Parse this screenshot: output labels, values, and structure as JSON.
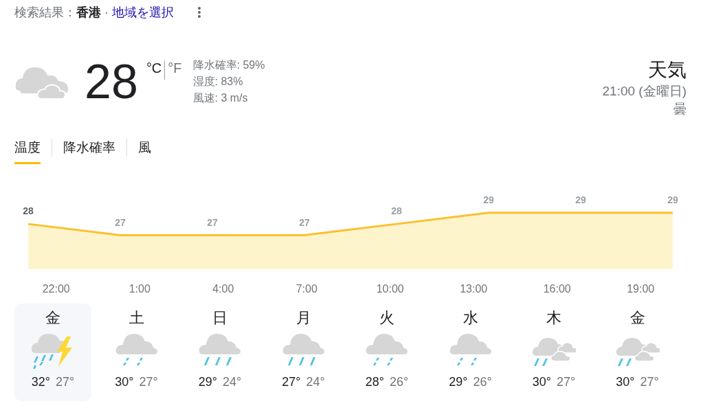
{
  "search_header": {
    "prefix": "検索結果：",
    "place": "香港",
    "separator": "·",
    "link": "地域を選択"
  },
  "current": {
    "temperature": "28",
    "units": [
      {
        "label": "°C",
        "selected": true
      },
      {
        "label": "°F",
        "selected": false
      }
    ],
    "details": [
      "降水確率: 59%",
      "湿度: 83%",
      "風速: 3 m/s"
    ],
    "title": "天気",
    "time": "21:00 (金曜日)",
    "condition": "曇"
  },
  "tabs": [
    {
      "label": "温度",
      "selected": true
    },
    {
      "label": "降水確率",
      "selected": false
    },
    {
      "label": "風",
      "selected": false
    }
  ],
  "chart": {
    "chart_data": {
      "type": "area",
      "categories": [
        null,
        null,
        null,
        null,
        null,
        null,
        null,
        null
      ],
      "series": [
        {
          "color": "#fbc02d",
          "values": [
            28,
            27,
            27,
            27,
            28,
            29,
            29,
            29
          ]
        }
      ],
      "data_labels": true
    },
    "times": [
      "22:00",
      "1:00",
      "4:00",
      "7:00",
      "10:00",
      "13:00",
      "16:00",
      "19:00"
    ]
  },
  "days": [
    {
      "day": "金",
      "kind": "thunder-rain",
      "high": "32°",
      "low": "27°",
      "selected": true
    },
    {
      "day": "土",
      "kind": "light-rain",
      "high": "30°",
      "low": "27°",
      "selected": false
    },
    {
      "day": "日",
      "kind": "rain",
      "high": "29°",
      "low": "24°",
      "selected": false
    },
    {
      "day": "月",
      "kind": "rain",
      "high": "27°",
      "low": "24°",
      "selected": false
    },
    {
      "day": "火",
      "kind": "light-rain",
      "high": "28°",
      "low": "26°",
      "selected": false
    },
    {
      "day": "水",
      "kind": "light-rain",
      "high": "29°",
      "low": "26°",
      "selected": false
    },
    {
      "day": "木",
      "kind": "partly-rain",
      "high": "30°",
      "low": "27°",
      "selected": false
    },
    {
      "day": "金",
      "kind": "partly-rain",
      "high": "30°",
      "low": "27°",
      "selected": false
    }
  ]
}
